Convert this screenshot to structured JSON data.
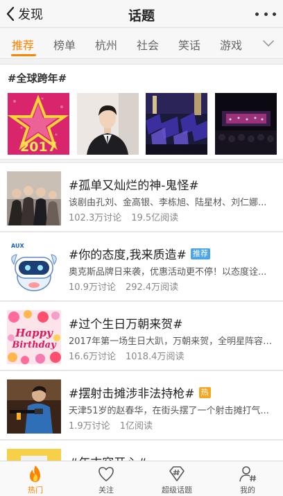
{
  "nav": {
    "back_label": "发现",
    "title": "话题"
  },
  "tabs": [
    "推荐",
    "榜单",
    "杭州",
    "社会",
    "笑话",
    "游戏"
  ],
  "featured": {
    "title": "#全球跨年#",
    "thumb1_text": "2017"
  },
  "topics": [
    {
      "title": "#孤单又灿烂的神-鬼怪#",
      "badge": "",
      "desc": "该剧由孔刘、金高银、李栋旭、陆星材、刘仁娜...",
      "discussions": "102.3万讨论",
      "reads": "19.5亿阅读"
    },
    {
      "title": "#你的态度,我来质造#",
      "badge": "推荐",
      "desc": "奥克斯品牌日来袭，优惠活动更不停！以态度诠...",
      "discussions": "10.9万讨论",
      "reads": "292.4万阅读",
      "logo": "AUX"
    },
    {
      "title": "#过个生日万朝来贺#",
      "badge": "",
      "desc": "2017年第一场生日大趴，万朝来贺，全明星阵容引...",
      "discussions": "16.6万讨论",
      "reads": "1018.4万阅读",
      "pic_line1": "Happy",
      "pic_line2": "Birthday"
    },
    {
      "title": "#摆射击摊涉非法持枪#",
      "badge": "热",
      "desc": "天津51岁的赵春华，在街头摆了一个射击摊打气...",
      "discussions": "1.9万讨论",
      "reads": "1亿阅读"
    },
    {
      "title": "#年末容开心#"
    }
  ],
  "tabbar": [
    "热门",
    "关注",
    "超级话题",
    "我的"
  ],
  "colors": {
    "accent": "#ff8200",
    "badge_blue": "#4aa4e6",
    "badge_hot": "#f5a623"
  }
}
